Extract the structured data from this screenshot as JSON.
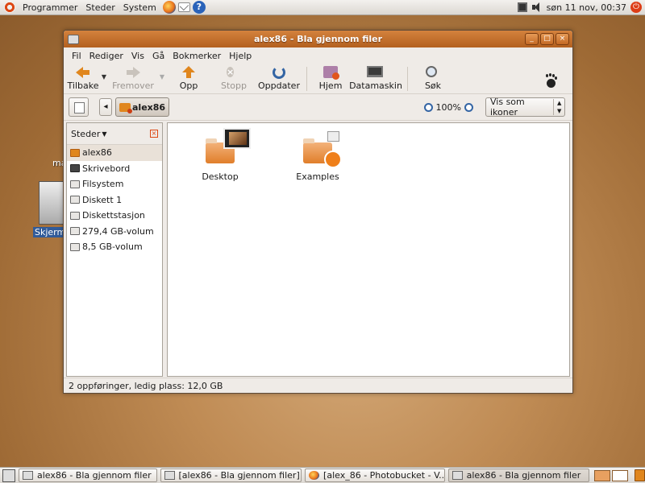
{
  "top_panel": {
    "menus": [
      "Programmer",
      "Steder",
      "System"
    ],
    "clock": "søn 11 nov, 00:37",
    "launchers": [
      "firefox-icon",
      "mail-icon",
      "help-icon"
    ]
  },
  "desktop": {
    "partial_label": "ma",
    "screenshot_label": "Skjerm"
  },
  "window": {
    "title": "alex86 - Bla gjennom filer",
    "controls": {
      "minimize": "_",
      "maximize": "□",
      "close": "×"
    },
    "menu": {
      "file": "Fil",
      "edit": "Rediger",
      "view": "Vis",
      "go": "Gå",
      "bookmarks": "Bokmerker",
      "help": "Hjelp"
    },
    "toolbar": {
      "back": "Tilbake",
      "forward": "Fremover",
      "up": "Opp",
      "stop": "Stopp",
      "reload": "Oppdater",
      "home": "Hjem",
      "computer": "Datamaskin",
      "search": "Søk"
    },
    "location": {
      "current": "alex86",
      "zoom": "100%",
      "view_mode": "Vis som ikoner"
    },
    "sidebar": {
      "header": "Steder",
      "places": [
        {
          "label": "alex86",
          "icon": "home-folder-icon"
        },
        {
          "label": "Skrivebord",
          "icon": "desktop-icon"
        },
        {
          "label": "Filsystem",
          "icon": "drive-icon"
        },
        {
          "label": "Diskett 1",
          "icon": "floppy-icon"
        },
        {
          "label": "Diskettstasjon",
          "icon": "floppy-icon"
        },
        {
          "label": "279,4 GB-volum",
          "icon": "drive-icon"
        },
        {
          "label": "8,5 GB-volum",
          "icon": "drive-icon"
        }
      ]
    },
    "files": [
      {
        "name": "Desktop",
        "icon": "folder-icon"
      },
      {
        "name": "Examples",
        "icon": "folder-icon"
      }
    ],
    "status": "2 oppføringer, ledig plass: 12,0 GB"
  },
  "taskbar": {
    "tasks": [
      "alex86 - Bla gjennom filer",
      "[alex86 - Bla gjennom filer]",
      "[alex_86 - Photobucket - V...",
      "alex86 - Bla gjennom filer"
    ]
  }
}
